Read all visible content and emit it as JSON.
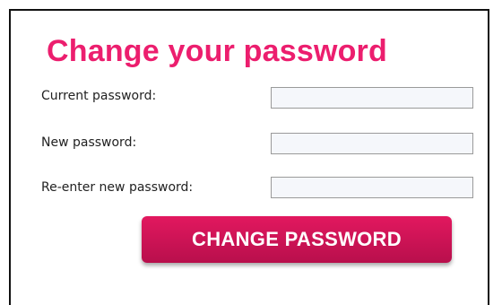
{
  "title": "Change your password",
  "fields": {
    "current": {
      "label": "Current password:",
      "value": ""
    },
    "new": {
      "label": "New password:",
      "value": ""
    },
    "reenter": {
      "label": "Re-enter new password:",
      "value": ""
    }
  },
  "submit_label": "CHANGE PASSWORD",
  "colors": {
    "accent": "#ec1e6e",
    "button_top": "#e2185f",
    "button_bottom": "#b80f4c",
    "input_bg": "#f5f7fb",
    "input_border": "#9a9a9a"
  }
}
